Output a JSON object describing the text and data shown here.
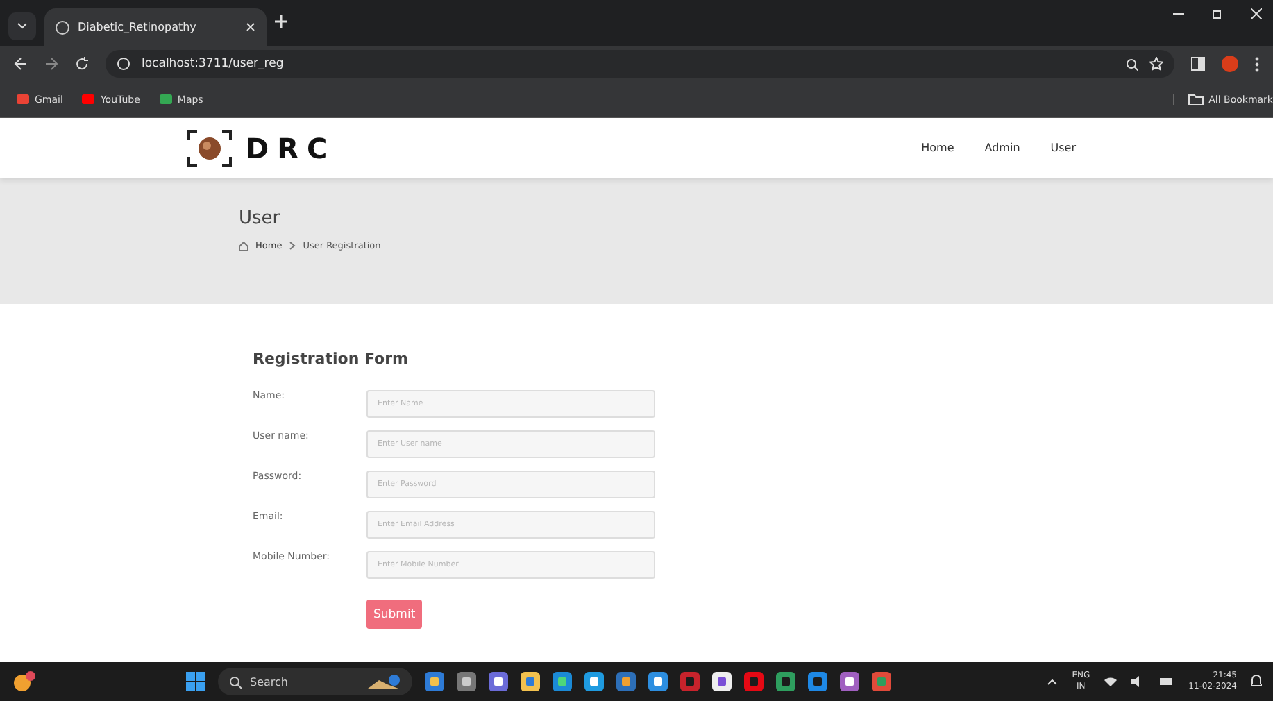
{
  "browser": {
    "tabs": [
      {
        "title": "Diabetic_Retinopathy",
        "selected": true
      }
    ],
    "url": "localhost:3711/user_reg",
    "bookmarks": [
      "Gmail",
      "YouTube",
      "Maps"
    ],
    "all_bookmarks": "All Bookmark"
  },
  "header": {
    "logo": "DRC",
    "nav": [
      "Home",
      "Admin",
      "User"
    ]
  },
  "banner": {
    "title": "User",
    "breadcrumb": [
      "Home",
      "User Registration"
    ]
  },
  "form": {
    "title": "Registration Form",
    "fields": [
      {
        "label": "Name:",
        "placeholder": "Enter Name"
      },
      {
        "label": "User name:",
        "placeholder": "Enter User name"
      },
      {
        "label": "Password:",
        "placeholder": "Enter Password"
      },
      {
        "label": "Email:",
        "placeholder": "Enter Email Address"
      },
      {
        "label": "Mobile Number:",
        "placeholder": "Enter Mobile Number"
      }
    ],
    "submit": "Submit"
  },
  "taskbar": {
    "search": "Search",
    "language": "ENG",
    "region": "IN",
    "time": "21:45",
    "date": "11-02-2024"
  }
}
